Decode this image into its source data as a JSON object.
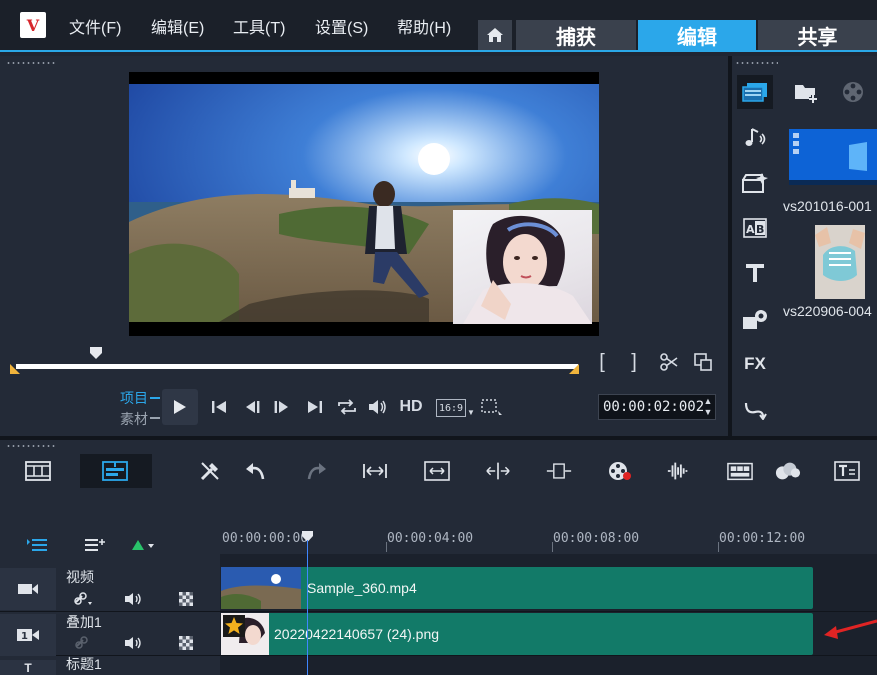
{
  "menu": {
    "file": "文件(F)",
    "edit": "编辑(E)",
    "tools": "工具(T)",
    "settings": "设置(S)",
    "help": "帮助(H)"
  },
  "tabs": {
    "capture": "捕获",
    "edit": "编辑",
    "share": "共享",
    "active": "编辑"
  },
  "preview": {
    "mode_project": "项目",
    "mode_clip": "素材",
    "hd_label": "HD",
    "aspect_label": "16:9",
    "timecode": "00:00:02:002",
    "mark_in": "[",
    "mark_out": "]"
  },
  "library": {
    "items": [
      {
        "label": "vs201016-001"
      },
      {
        "label": "vs220906-004"
      }
    ]
  },
  "sidebar_icons": [
    "media-icon",
    "audio-icon",
    "instant-project-icon",
    "transition-icon",
    "title-icon",
    "graphic-icon",
    "fx-icon",
    "path-icon"
  ],
  "toolbar_icons": [
    "storyboard-view-icon",
    "timeline-view-icon",
    "tools-icon",
    "undo-icon",
    "redo-icon",
    "fit-project-icon",
    "resize-icon",
    "split-icon",
    "trim-icon",
    "record-icon",
    "audio-mix-icon",
    "multicam-icon",
    "mask-icon",
    "subtitle-icon"
  ],
  "timeline": {
    "ruler": [
      "00:00:00:00",
      "00:00:04:00",
      "00:00:08:00",
      "00:00:12:00"
    ],
    "tracks": [
      {
        "name": "视频",
        "clip": "Sample_360.mp4"
      },
      {
        "name": "叠加1",
        "clip": "20220422140657 (24).png"
      },
      {
        "name": "标题1",
        "clip": ""
      }
    ]
  },
  "colors": {
    "accent": "#2ba7ea",
    "clip": "#127a68",
    "arrow": "#e02424",
    "trim_handle": "#f0b43c"
  }
}
